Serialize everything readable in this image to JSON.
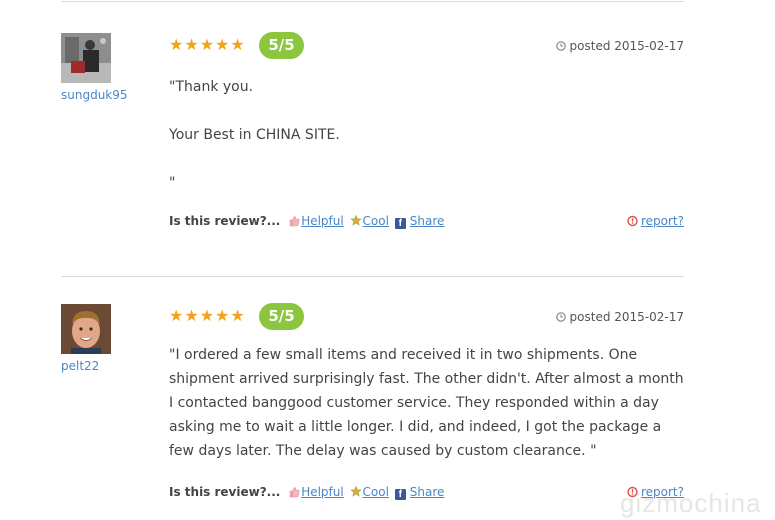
{
  "reviews": [
    {
      "username": "sungduk95",
      "stars": "★★★★★",
      "score": "5/5",
      "posted": "posted 2015-02-17",
      "body": [
        "\"Thank you.",
        "Your Best in CHINA SITE.",
        "\""
      ],
      "prompt": "Is this review?...",
      "helpful": "Helpful",
      "cool": "Cool",
      "share": "Share",
      "report": "report?"
    },
    {
      "username": "pelt22",
      "stars": "★★★★★",
      "score": "5/5",
      "posted": "posted 2015-02-17",
      "body": [
        "\"I ordered a few small items and received it in two shipments. One shipment arrived surprisingly fast. The other didn't. After almost a month I contacted banggood customer service. They responded within a day asking me to wait a little longer. I did, and indeed, I got the package a few days later. The delay was caused by custom clearance. \""
      ],
      "prompt": "Is this review?...",
      "helpful": "Helpful",
      "cool": "Cool",
      "share": "Share",
      "report": "report?"
    }
  ],
  "watermark": "gizmochina",
  "colors": {
    "star": "#f5a21b",
    "score_badge": "#8cc63f",
    "link": "#4a86c7",
    "report_icon": "#d9534f"
  }
}
